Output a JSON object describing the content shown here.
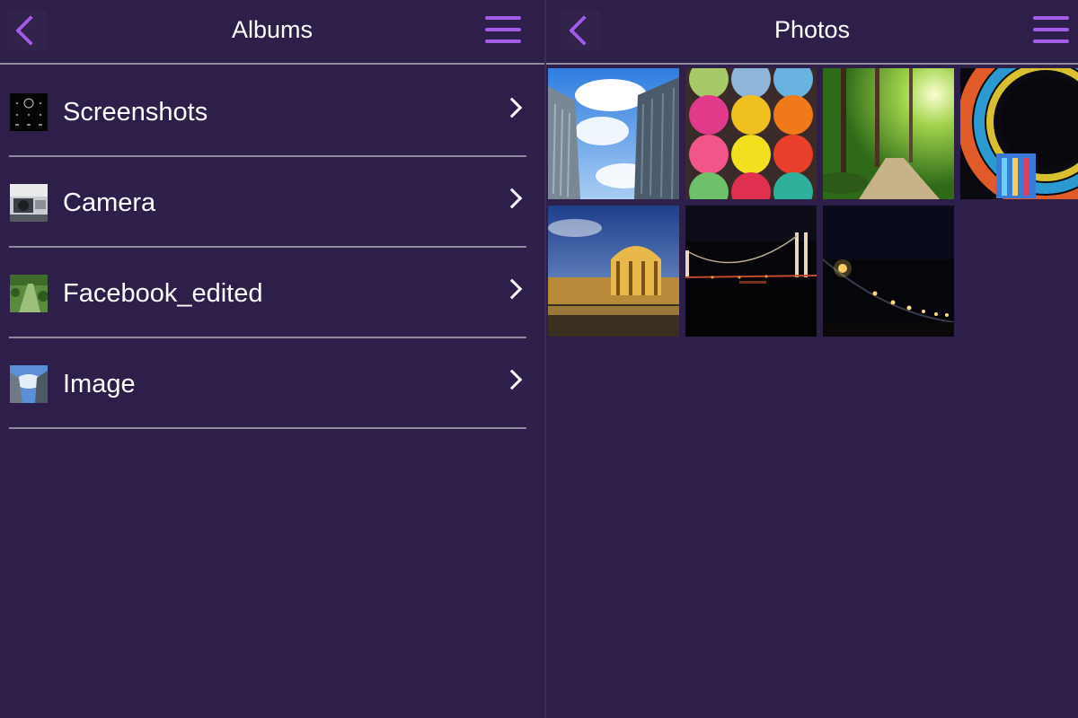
{
  "albums_pane": {
    "title": "Albums",
    "back_icon": "chevron-left-icon",
    "menu_icon": "hamburger-menu-icon",
    "items": [
      {
        "label": "Screenshots",
        "thumbnail": "screenshot-thumbnail"
      },
      {
        "label": "Camera",
        "thumbnail": "camera-thumbnail"
      },
      {
        "label": "Facebook_edited",
        "thumbnail": "garden-thumbnail"
      },
      {
        "label": "Image",
        "thumbnail": "skyscraper-thumbnail"
      }
    ]
  },
  "photos_pane": {
    "title": "Photos",
    "back_icon": "chevron-left-icon",
    "menu_icon": "hamburger-menu-icon",
    "photos": [
      {
        "subject": "skyscrapers-sky"
      },
      {
        "subject": "colorful-yarn"
      },
      {
        "subject": "sunlit-forest"
      },
      {
        "subject": "stained-glass-dome"
      },
      {
        "subject": "palace-of-fine-arts"
      },
      {
        "subject": "bridge-at-night"
      },
      {
        "subject": "night-street-lights"
      }
    ]
  },
  "colors": {
    "background": "#2e1f4a",
    "accent": "#a45ce8",
    "divider": "#8f8a9c",
    "text": "#ffffff"
  }
}
